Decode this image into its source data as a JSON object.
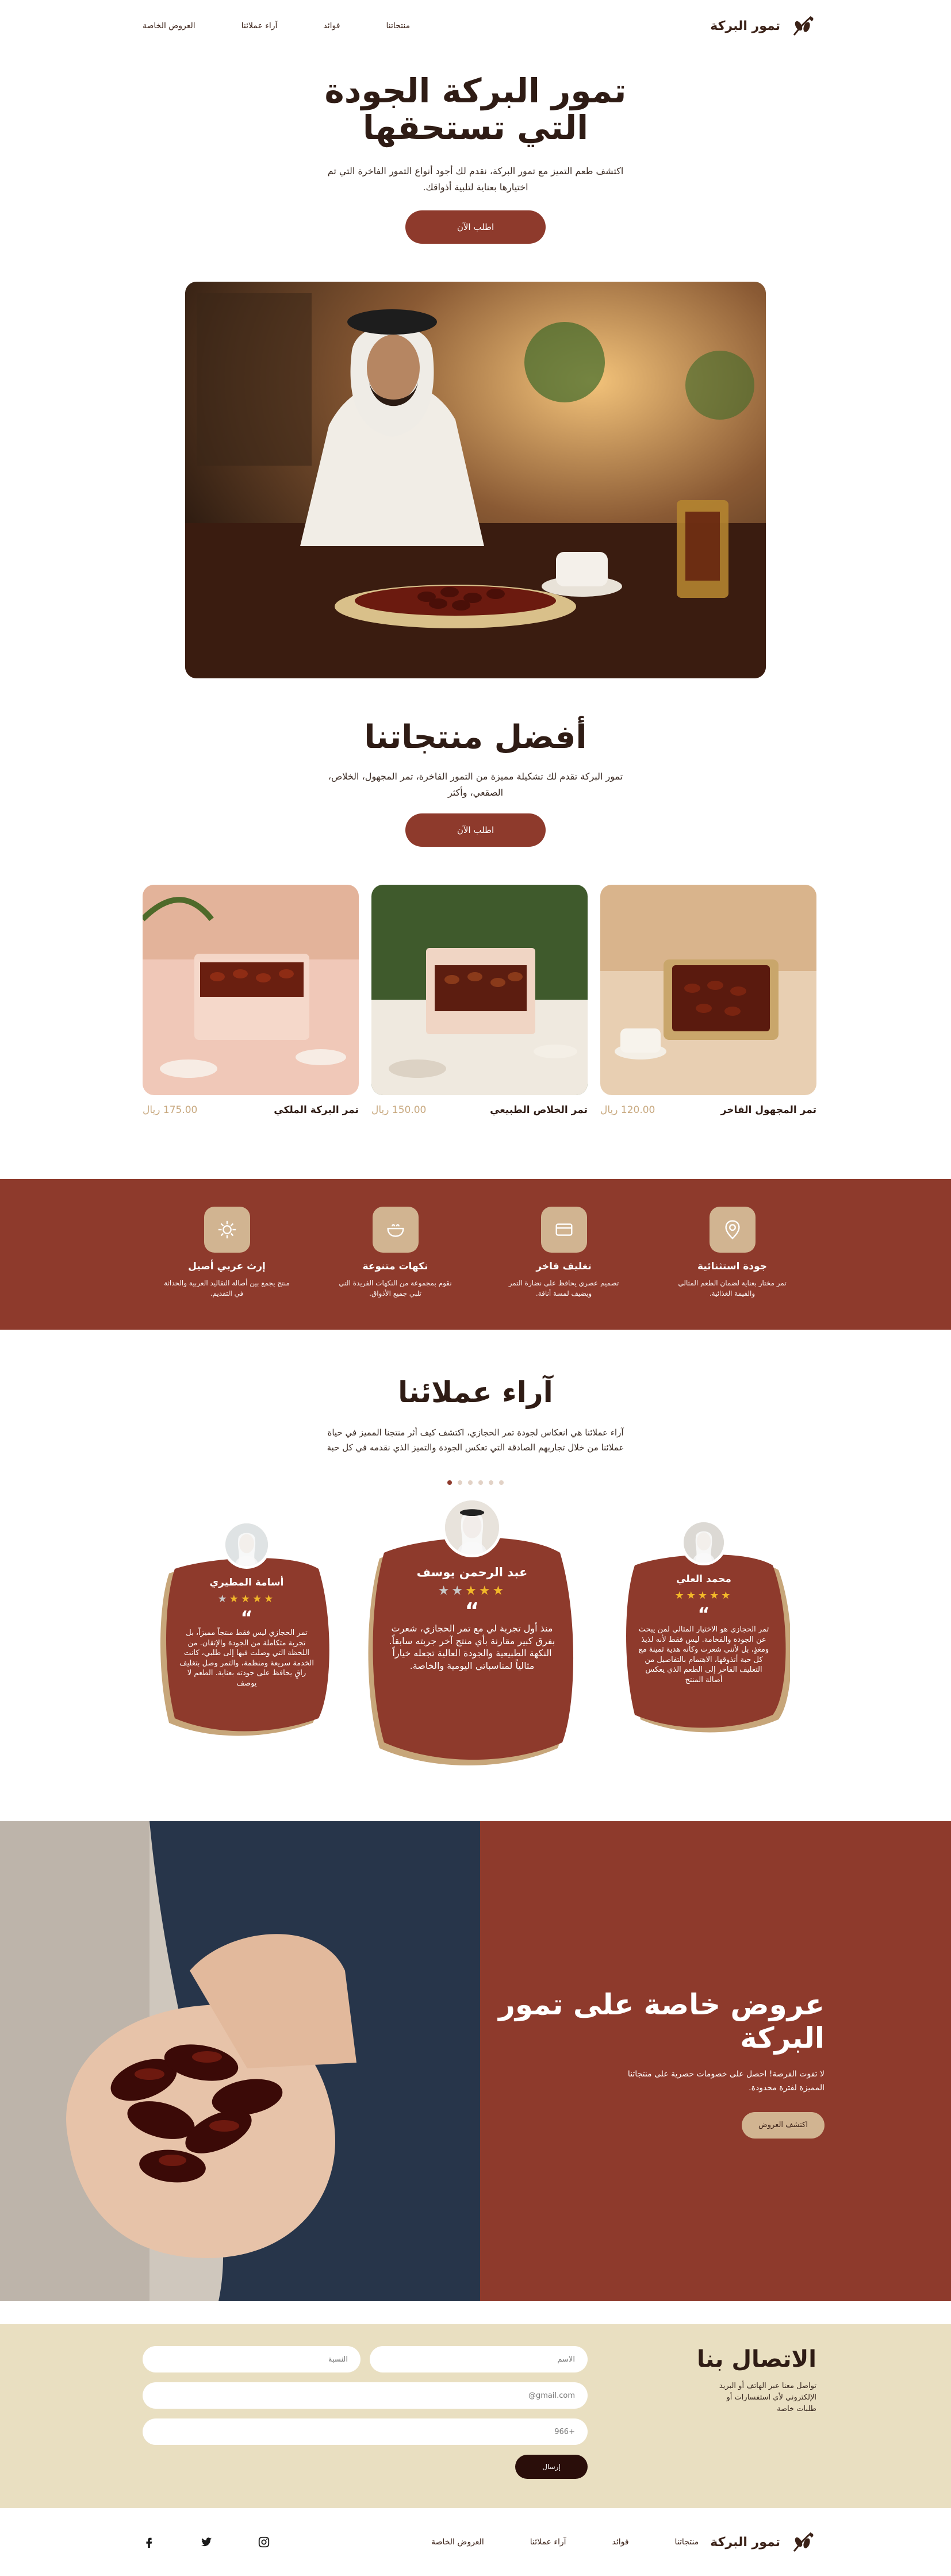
{
  "nav": {
    "brand": "تمور البركة",
    "links": [
      "منتجاتنا",
      "فوائد",
      "آراء عملائنا",
      "العروض الخاصة"
    ]
  },
  "hero": {
    "title": "تمور البركة الجودة التي تستحقها",
    "subtitle": "اكتشف طعم التميز مع تمور البركة، نقدم لك أجود أنواع التمور الفاخرة التي تم اختيارها بعناية لتلبية أذواقك.",
    "cta": "اطلب الآن"
  },
  "best": {
    "title": "أفضل منتجاتنا",
    "subtitle": "تمور البركة تقدم لك تشكيلة مميزة من التمور الفاخرة، تمر المجهول، الخلاص، الصقعي، وأكثر",
    "cta": "اطلب الآن",
    "products": [
      {
        "name": "تمر المجهول الفاخر",
        "price": "120.00 ريال"
      },
      {
        "name": "تمر الخلاص الطبيعي",
        "price": "150.00 ريال"
      },
      {
        "name": "تمر البركة الملكي",
        "price": "175.00 ريال"
      }
    ]
  },
  "features": [
    {
      "icon": "location-pin-icon",
      "title": "جودة استثنائية",
      "desc": "تمر مختار بعناية لضمان الطعم المثالي والقيمة الغذائية."
    },
    {
      "icon": "gift-card-icon",
      "title": "تغليف فاخر",
      "desc": "تصميم عصري يحافظ على نضارة التمر ويضيف لمسة أناقة."
    },
    {
      "icon": "mix-bowl-icon",
      "title": "نكهات متنوعة",
      "desc": "نقوم بمجموعة من النكهات الفريدة التي تلبي جميع الأذواق."
    },
    {
      "icon": "ornament-icon",
      "title": "إرث عربي أصيل",
      "desc": "منتج يجمع بين أصالة التقاليد العربية والحداثة في التقديم."
    }
  ],
  "testimonials": {
    "title": "آراء عملائنا",
    "subtitle": "آراء عملائنا هي انعكاس لجودة تمر الحجازي، اكتشف كيف أثر منتجنا المميز في حياة عملائنا من خلال تجاربهم الصادقة التي تعكس الجودة والتميز الذي نقدمه في كل حبة",
    "reviews": [
      {
        "name": "محمد العلي",
        "stars": 5,
        "text": "تمر الحجازي هو الاختيار المثالي لمن يبحث عن الجودة والفخامة. ليس فقط لأنه لذيذ ومغذٍ، بل لأنني شعرت وكأنه هدية ثمينة مع كل حبة أتذوقها، الاهتمام بالتفاصيل من التغليف الفاخر إلى الطعم الذي يعكس أصالة المنتج"
      },
      {
        "name": "عبد الرحمن يوسف",
        "stars": 3,
        "text": "منذ أول تجربة لي مع تمر الحجازي، شعرت بفرق كبير مقارنة بأي منتج آخر جربته سابقاً. النكهة الطبيعية والجودة العالية تجعله خياراً مثالياً لمناسباتي اليومية والخاصة."
      },
      {
        "name": "أسامة المطيري",
        "stars": 4,
        "text": "تمر الحجازي ليس فقط منتجاً مميزاً، بل تجربة متكاملة من الجودة والإتقان. من اللحظة التي وصلت فيها إلى طلبي، كانت الخدمة سريعة ومنظمة، والتمر وصل بتغليف راقٍ يحافظ على جودته بعناية. الطعم لا يوصف"
      }
    ]
  },
  "offers": {
    "title": "عروض خاصة على تمور البركة",
    "subtitle": "لا تفوت الفرصة! احصل على خصومات حصرية على منتجاتنا المميزة لفترة محدودة.",
    "cta": "اكتشف العروض"
  },
  "contact": {
    "title": "الاتصال بنا",
    "subtitle": "تواصل معنا عبر الهاتف أو البريد الإلكتروني لأي استفسارات أو طلبات خاصة",
    "name_placeholder": "الاسم",
    "surname_placeholder": "النسبة",
    "email_placeholder": "gmail.com@",
    "phone_placeholder": "+966",
    "send": "إرسال"
  },
  "footer": {
    "brand": "تمور البركة",
    "links": [
      "منتجاتنا",
      "فوائد",
      "آراء عملائنا",
      "العروض الخاصة"
    ],
    "social": [
      "instagram-icon",
      "twitter-icon",
      "facebook-icon"
    ]
  },
  "colors": {
    "primary": "#8e3a2c",
    "sand": "#d1b491",
    "cream": "#e9dfc1",
    "dark": "#2a0e0a"
  }
}
